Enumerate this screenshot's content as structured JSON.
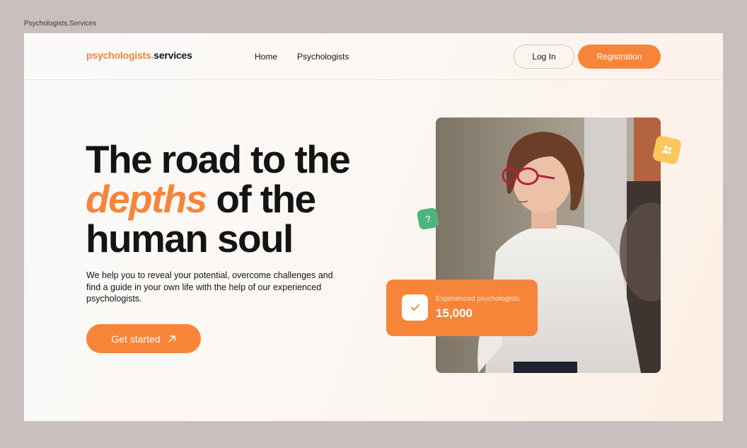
{
  "window": {
    "title": "Psychologists.Services"
  },
  "header": {
    "logo_accent": "psychologists.",
    "logo_rest": "services",
    "nav": [
      {
        "label": "Home"
      },
      {
        "label": "Psychologists"
      }
    ],
    "login_label": "Log In",
    "registration_label": "Registration"
  },
  "hero": {
    "line1": "The road to the",
    "accent_word": "depths",
    "line2_rest": " of the",
    "line3": "human soul",
    "description": "We help you to reveal your potential, overcome challenges and find a guide in your own life with the help of our experienced psychologists.",
    "cta_label": "Get started",
    "cta_icon": "arrow-up-right-icon"
  },
  "stat": {
    "label": "Experienced psychologists",
    "value": "15,000",
    "icon": "check-icon"
  },
  "badges": {
    "question_mark": "?",
    "people_icon": "users-icon"
  },
  "colors": {
    "accent": "#f6853a",
    "green": "#4eb47d",
    "yellow": "#fbc75d",
    "frame_bg": "#c9bfbf"
  }
}
